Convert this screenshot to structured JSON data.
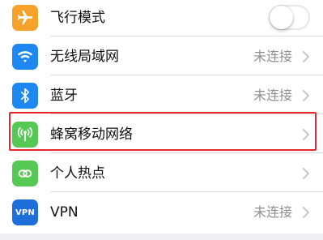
{
  "colors": {
    "airplane_icon_bg": "#f5a12a",
    "wifi_icon_bg": "#1e88f2",
    "bluetooth_icon_bg": "#1e88f2",
    "cellular_icon_bg": "#55c953",
    "hotspot_icon_bg": "#55c953",
    "vpn_icon_bg": "#1e6fd9",
    "highlight_border": "#e8262a"
  },
  "settings": {
    "airplane": {
      "label": "飞行模式",
      "icon": "airplane-icon",
      "toggle_on": false
    },
    "wifi": {
      "label": "无线局域网",
      "value": "未连接",
      "icon": "wifi-icon"
    },
    "bluetooth": {
      "label": "蓝牙",
      "value": "未连接",
      "icon": "bluetooth-icon"
    },
    "cellular": {
      "label": "蜂窝移动网络",
      "icon": "cellular-icon",
      "highlighted": true
    },
    "hotspot": {
      "label": "个人热点",
      "icon": "hotspot-icon"
    },
    "vpn": {
      "label": "VPN",
      "value": "未连接",
      "icon_text": "VPN"
    }
  }
}
